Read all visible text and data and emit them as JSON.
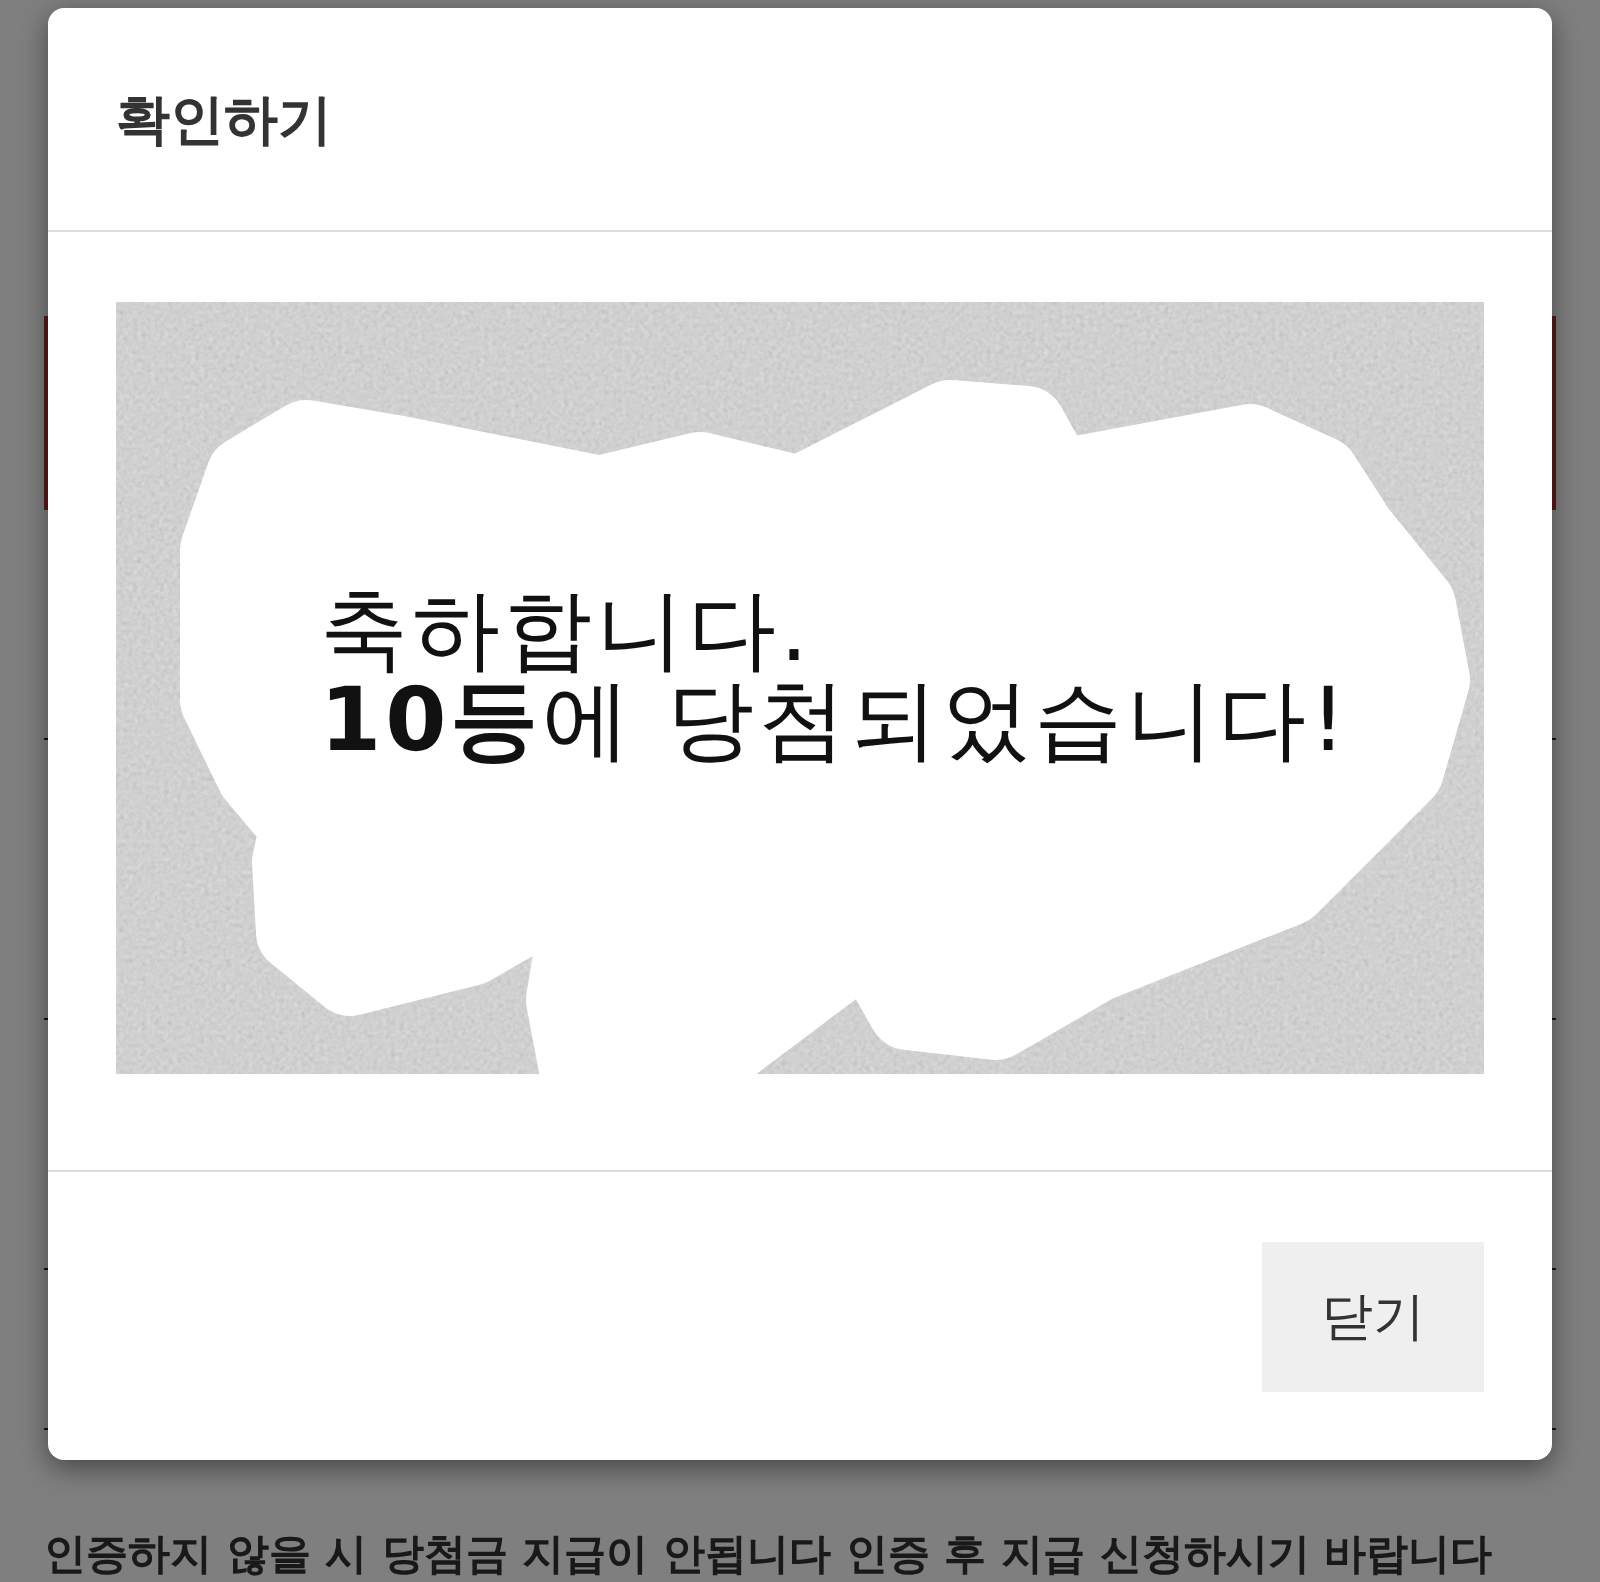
{
  "dialog": {
    "title": "확인하기",
    "scratch_card": {
      "message": [
        "축하합니다.",
        "**10등**에 당첨되었습니다!"
      ]
    },
    "buttons": [
      {
        "label": "닫기"
      }
    ]
  },
  "page": {
    "notice": "인증하지 않을 시 당첨금 지급이 안됩니다 인증 후 지급 신청하시기 바랍니다"
  }
}
